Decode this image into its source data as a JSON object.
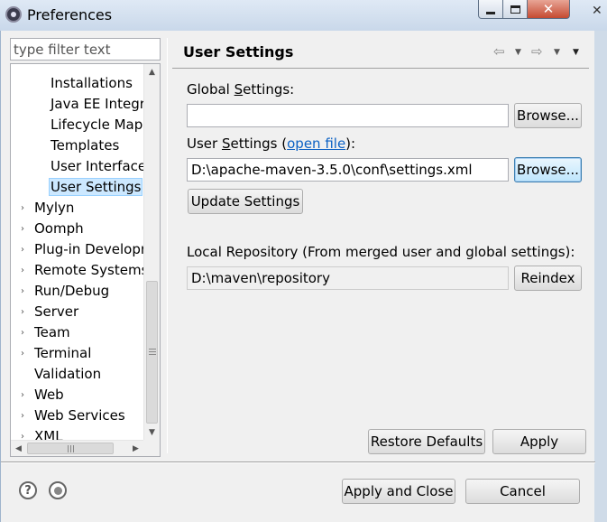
{
  "window": {
    "title": "Preferences"
  },
  "filter": {
    "placeholder": "type filter text"
  },
  "tree": {
    "items": [
      {
        "label": "Installations",
        "arrow": ""
      },
      {
        "label": "Java EE Integra",
        "arrow": ""
      },
      {
        "label": "Lifecycle Mapp",
        "arrow": ""
      },
      {
        "label": "Templates",
        "arrow": ""
      },
      {
        "label": "User Interface",
        "arrow": ""
      },
      {
        "label": "User Settings",
        "arrow": "",
        "selected": true
      },
      {
        "label": "Mylyn",
        "arrow": "›"
      },
      {
        "label": "Oomph",
        "arrow": "›"
      },
      {
        "label": "Plug-in Developr",
        "arrow": "›"
      },
      {
        "label": "Remote Systems",
        "arrow": "›"
      },
      {
        "label": "Run/Debug",
        "arrow": "›"
      },
      {
        "label": "Server",
        "arrow": "›"
      },
      {
        "label": "Team",
        "arrow": "›"
      },
      {
        "label": "Terminal",
        "arrow": "›"
      },
      {
        "label": "Validation",
        "arrow": ""
      },
      {
        "label": "Web",
        "arrow": "›"
      },
      {
        "label": "Web Services",
        "arrow": "›"
      },
      {
        "label": "XML",
        "arrow": "›"
      }
    ]
  },
  "page": {
    "title": "User Settings",
    "global_settings_pre": "Global ",
    "global_settings_mnemonic": "S",
    "global_settings_post": "ettings:",
    "global_settings_value": "",
    "user_settings_pre": "User ",
    "user_settings_mnemonic": "S",
    "user_settings_mid": "ettings (",
    "open_file_link": "open file",
    "user_settings_post": "):",
    "user_settings_value": "D:\\apache-maven-3.5.0\\conf\\settings.xml",
    "local_repo_label": "Local Repository (From merged user and global settings):",
    "local_repo_value": "D:\\maven\\repository"
  },
  "buttons": {
    "browse": "Browse...",
    "update_settings": "Update Settings",
    "reindex": "Reindex",
    "restore_defaults": "Restore Defaults",
    "apply": "Apply",
    "apply_and_close": "Apply and Close",
    "cancel": "Cancel"
  },
  "icons": {
    "help": "?",
    "back": "⇦",
    "forward": "⇨",
    "dropdown": "▼"
  }
}
